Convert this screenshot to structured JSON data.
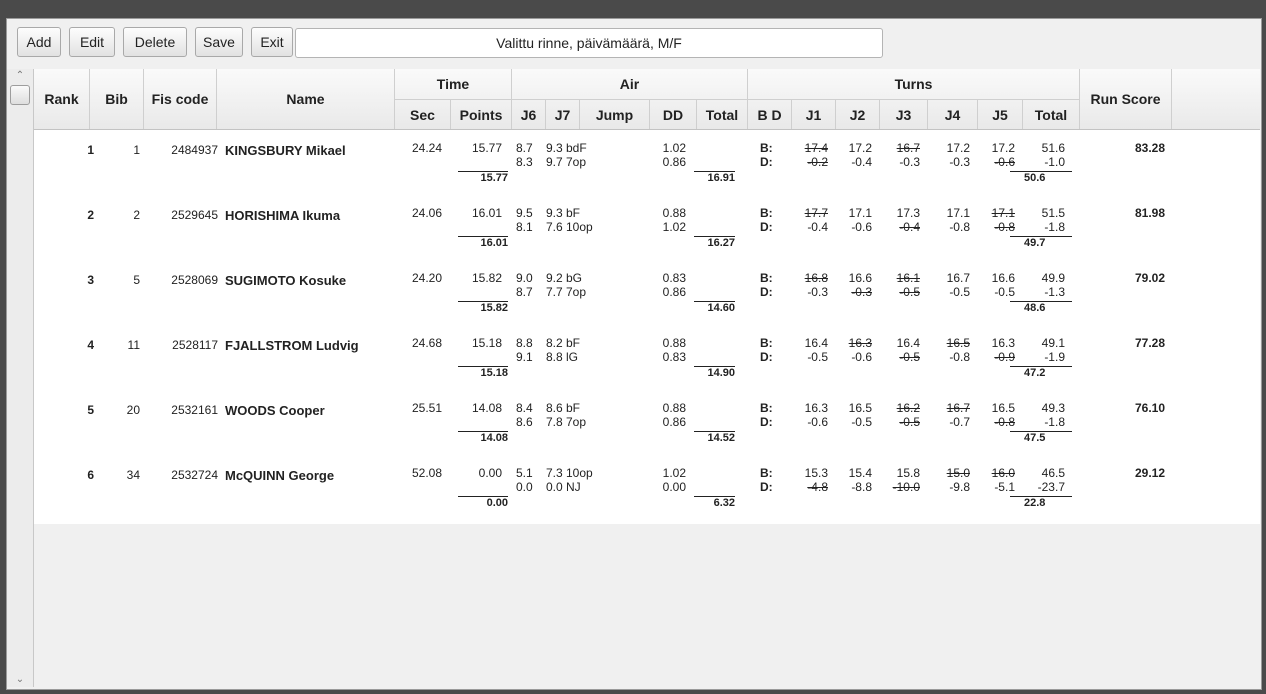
{
  "toolbar": {
    "add": "Add",
    "edit": "Edit",
    "delete": "Delete",
    "save": "Save",
    "exit": "Exit",
    "selection_text": "Valittu rinne, päivämäärä, M/F"
  },
  "headers": {
    "rank": "Rank",
    "bib": "Bib",
    "fis_code": "Fis code",
    "name": "Name",
    "time": "Time",
    "sec": "Sec",
    "points": "Points",
    "air": "Air",
    "j6": "J6",
    "j7": "J7",
    "jump": "Jump",
    "dd": "DD",
    "air_total": "Total",
    "turns": "Turns",
    "bd": "B D",
    "j1": "J1",
    "j2": "J2",
    "j3": "J3",
    "j4": "J4",
    "j5": "J5",
    "turns_total": "Total",
    "run_score": "Run Score"
  },
  "rows": [
    {
      "rank": "1",
      "bib": "1",
      "fis": "2484937",
      "name": "KINGSBURY Mikael",
      "sec": "24.24",
      "points": "15.77",
      "points_total": "15.77",
      "j6a": "8.7",
      "j7a": "9.3",
      "jumpa": "bdF",
      "dda": "1.02",
      "j6b": "8.3",
      "j7b": "9.7",
      "jumpb": "7op",
      "ddb": "0.86",
      "air_total": "16.91",
      "b_label": "B:",
      "d_label": "D:",
      "b": [
        "17.4",
        "17.2",
        "16.7",
        "17.2",
        "17.2"
      ],
      "b_strike": [
        true,
        false,
        true,
        false,
        false
      ],
      "b_total": "51.6",
      "d": [
        "-0.2",
        "-0.4",
        "-0.3",
        "-0.3",
        "-0.6"
      ],
      "d_strike": [
        true,
        false,
        false,
        false,
        true
      ],
      "d_total": "-1.0",
      "turns_total": "50.6",
      "run_score": "83.28"
    },
    {
      "rank": "2",
      "bib": "2",
      "fis": "2529645",
      "name": "HORISHIMA Ikuma",
      "sec": "24.06",
      "points": "16.01",
      "points_total": "16.01",
      "j6a": "9.5",
      "j7a": "9.3",
      "jumpa": "bF",
      "dda": "0.88",
      "j6b": "8.1",
      "j7b": "7.6",
      "jumpb": "10op",
      "ddb": "1.02",
      "air_total": "16.27",
      "b_label": "B:",
      "d_label": "D:",
      "b": [
        "17.7",
        "17.1",
        "17.3",
        "17.1",
        "17.1"
      ],
      "b_strike": [
        true,
        false,
        false,
        false,
        true
      ],
      "b_total": "51.5",
      "d": [
        "-0.4",
        "-0.6",
        "-0.4",
        "-0.8",
        "-0.8"
      ],
      "d_strike": [
        false,
        false,
        true,
        false,
        true
      ],
      "d_total": "-1.8",
      "turns_total": "49.7",
      "run_score": "81.98"
    },
    {
      "rank": "3",
      "bib": "5",
      "fis": "2528069",
      "name": "SUGIMOTO Kosuke",
      "sec": "24.20",
      "points": "15.82",
      "points_total": "15.82",
      "j6a": "9.0",
      "j7a": "9.2",
      "jumpa": "bG",
      "dda": "0.83",
      "j6b": "8.7",
      "j7b": "7.7",
      "jumpb": "7op",
      "ddb": "0.86",
      "air_total": "14.60",
      "b_label": "B:",
      "d_label": "D:",
      "b": [
        "16.8",
        "16.6",
        "16.1",
        "16.7",
        "16.6"
      ],
      "b_strike": [
        true,
        false,
        true,
        false,
        false
      ],
      "b_total": "49.9",
      "d": [
        "-0.3",
        "-0.3",
        "-0.5",
        "-0.5",
        "-0.5"
      ],
      "d_strike": [
        false,
        true,
        true,
        false,
        false
      ],
      "d_total": "-1.3",
      "turns_total": "48.6",
      "run_score": "79.02"
    },
    {
      "rank": "4",
      "bib": "11",
      "fis": "2528117",
      "name": "FJALLSTROM Ludvig",
      "sec": "24.68",
      "points": "15.18",
      "points_total": "15.18",
      "j6a": "8.8",
      "j7a": "8.2",
      "jumpa": "bF",
      "dda": "0.88",
      "j6b": "9.1",
      "j7b": "8.8",
      "jumpb": "lG",
      "ddb": "0.83",
      "air_total": "14.90",
      "b_label": "B:",
      "d_label": "D:",
      "b": [
        "16.4",
        "16.3",
        "16.4",
        "16.5",
        "16.3"
      ],
      "b_strike": [
        false,
        true,
        false,
        true,
        false
      ],
      "b_total": "49.1",
      "d": [
        "-0.5",
        "-0.6",
        "-0.5",
        "-0.8",
        "-0.9"
      ],
      "d_strike": [
        false,
        false,
        true,
        false,
        true
      ],
      "d_total": "-1.9",
      "turns_total": "47.2",
      "run_score": "77.28"
    },
    {
      "rank": "5",
      "bib": "20",
      "fis": "2532161",
      "name": "WOODS Cooper",
      "sec": "25.51",
      "points": "14.08",
      "points_total": "14.08",
      "j6a": "8.4",
      "j7a": "8.6",
      "jumpa": "bF",
      "dda": "0.88",
      "j6b": "8.6",
      "j7b": "7.8",
      "jumpb": "7op",
      "ddb": "0.86",
      "air_total": "14.52",
      "b_label": "B:",
      "d_label": "D:",
      "b": [
        "16.3",
        "16.5",
        "16.2",
        "16.7",
        "16.5"
      ],
      "b_strike": [
        false,
        false,
        true,
        true,
        false
      ],
      "b_total": "49.3",
      "d": [
        "-0.6",
        "-0.5",
        "-0.5",
        "-0.7",
        "-0.8"
      ],
      "d_strike": [
        false,
        false,
        true,
        false,
        true
      ],
      "d_total": "-1.8",
      "turns_total": "47.5",
      "run_score": "76.10"
    },
    {
      "rank": "6",
      "bib": "34",
      "fis": "2532724",
      "name": "McQUINN George",
      "sec": "52.08",
      "points": "0.00",
      "points_total": "0.00",
      "j6a": "5.1",
      "j7a": "7.3",
      "jumpa": "10op",
      "dda": "1.02",
      "j6b": "0.0",
      "j7b": "0.0",
      "jumpb": "NJ",
      "ddb": "0.00",
      "air_total": "6.32",
      "b_label": "B:",
      "d_label": "D:",
      "b": [
        "15.3",
        "15.4",
        "15.8",
        "15.0",
        "16.0"
      ],
      "b_strike": [
        false,
        false,
        false,
        true,
        true
      ],
      "b_total": "46.5",
      "d": [
        "-4.8",
        "-8.8",
        "-10.0",
        "-9.8",
        "-5.1"
      ],
      "d_strike": [
        true,
        false,
        true,
        false,
        false
      ],
      "d_total": "-23.7",
      "turns_total": "22.8",
      "run_score": "29.12"
    }
  ]
}
